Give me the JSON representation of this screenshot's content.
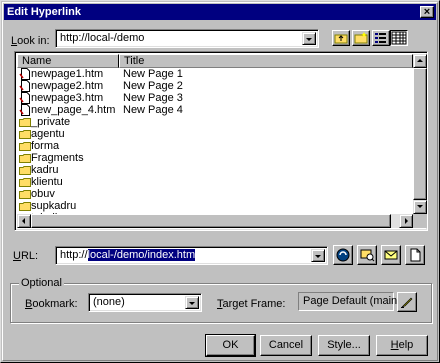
{
  "window": {
    "title": "Edit Hyperlink",
    "close_label": "×"
  },
  "look_in": {
    "label_prefix": "",
    "label_hot": "L",
    "label_rest": "ook in:",
    "value": "http://local-/demo"
  },
  "toolbar": [
    {
      "name": "up-folder-icon"
    },
    {
      "name": "new-folder-icon"
    },
    {
      "name": "list-view-icon"
    },
    {
      "name": "details-view-icon"
    }
  ],
  "file_list": {
    "columns": [
      "Name",
      "Title"
    ],
    "rows": [
      {
        "name": "newpage1.htm",
        "title": "New Page 1",
        "type": "page"
      },
      {
        "name": "newpage2.htm",
        "title": "New Page 2",
        "type": "page"
      },
      {
        "name": "newpage3.htm",
        "title": "New Page 3",
        "type": "page"
      },
      {
        "name": "new_page_4.htm",
        "title": "New Page 4",
        "type": "page"
      },
      {
        "name": "_private",
        "title": "",
        "type": "folder"
      },
      {
        "name": "agentu",
        "title": "",
        "type": "folder"
      },
      {
        "name": "forma",
        "title": "",
        "type": "folder"
      },
      {
        "name": "Fragments",
        "title": "",
        "type": "folder"
      },
      {
        "name": "kadru",
        "title": "",
        "type": "folder"
      },
      {
        "name": "klientu",
        "title": "",
        "type": "folder"
      },
      {
        "name": "obuv",
        "title": "",
        "type": "folder"
      },
      {
        "name": "supkadru",
        "title": "",
        "type": "folder"
      },
      {
        "name": "tehnika",
        "title": "",
        "type": "folder"
      }
    ]
  },
  "url": {
    "label_hot": "U",
    "label_rest": "RL:",
    "value_prefix": "http://",
    "value_selected": "local-/demo/index.htm"
  },
  "optional": {
    "group_title": "Optional",
    "bookmark_label_hot": "B",
    "bookmark_label_rest": "ookmark:",
    "bookmark_value": "(none)",
    "target_label_hot": "T",
    "target_label_rest": "arget Frame:",
    "target_value": "Page Default (main)"
  },
  "buttons": {
    "ok": "OK",
    "cancel": "Cancel",
    "style": "Style...",
    "help_hot": "H",
    "help_rest": "elp"
  },
  "colors": {
    "titlebar": "#000080",
    "face": "#c0c0c0",
    "selection": "#000080",
    "folder": "#ffdd66"
  }
}
